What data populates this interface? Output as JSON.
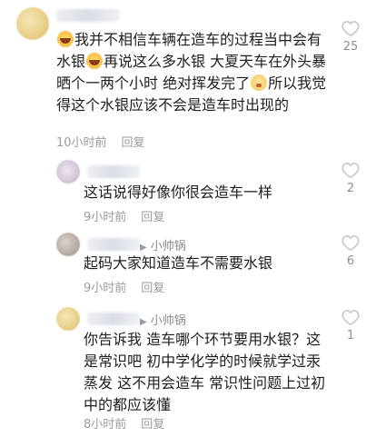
{
  "comments": [
    {
      "id": "c1",
      "text_parts": [
        "我并不相信车辆在造车的过程当中会有水银",
        "再说这么多水银 大夏天车在外头暴晒个一两个小时 绝对挥发完了",
        "所以我觉得这个水银应该不会是造车时出现的"
      ],
      "emojis": [
        "laugh-cry-emoji",
        "laugh-cry-emoji",
        "shy-emoji"
      ],
      "time": "10小时前",
      "reply_label": "回复",
      "likes": "25"
    },
    {
      "id": "c2",
      "text": "这话说得好像你很会造车一样",
      "time": "9小时前",
      "reply_label": "回复",
      "likes": "2"
    },
    {
      "id": "c3",
      "reply_to": "小帅锅",
      "text": "起码大家知道造车不需要水银",
      "time": "9小时前",
      "reply_label": "回复",
      "likes": "6"
    },
    {
      "id": "c4",
      "reply_to": "小帅锅",
      "text": "你告诉我 造车哪个环节要用水银？这是常识吧 初中学化学的时候就学过汞蒸发 这不用会造车 常识性问题上过初中的都应该懂",
      "time": "8小时前",
      "reply_label": "回复",
      "likes": "1"
    }
  ],
  "colors": {
    "text": "#1e1e1e",
    "meta": "#9b9b9b",
    "heart_outline": "#c8c8c8"
  }
}
